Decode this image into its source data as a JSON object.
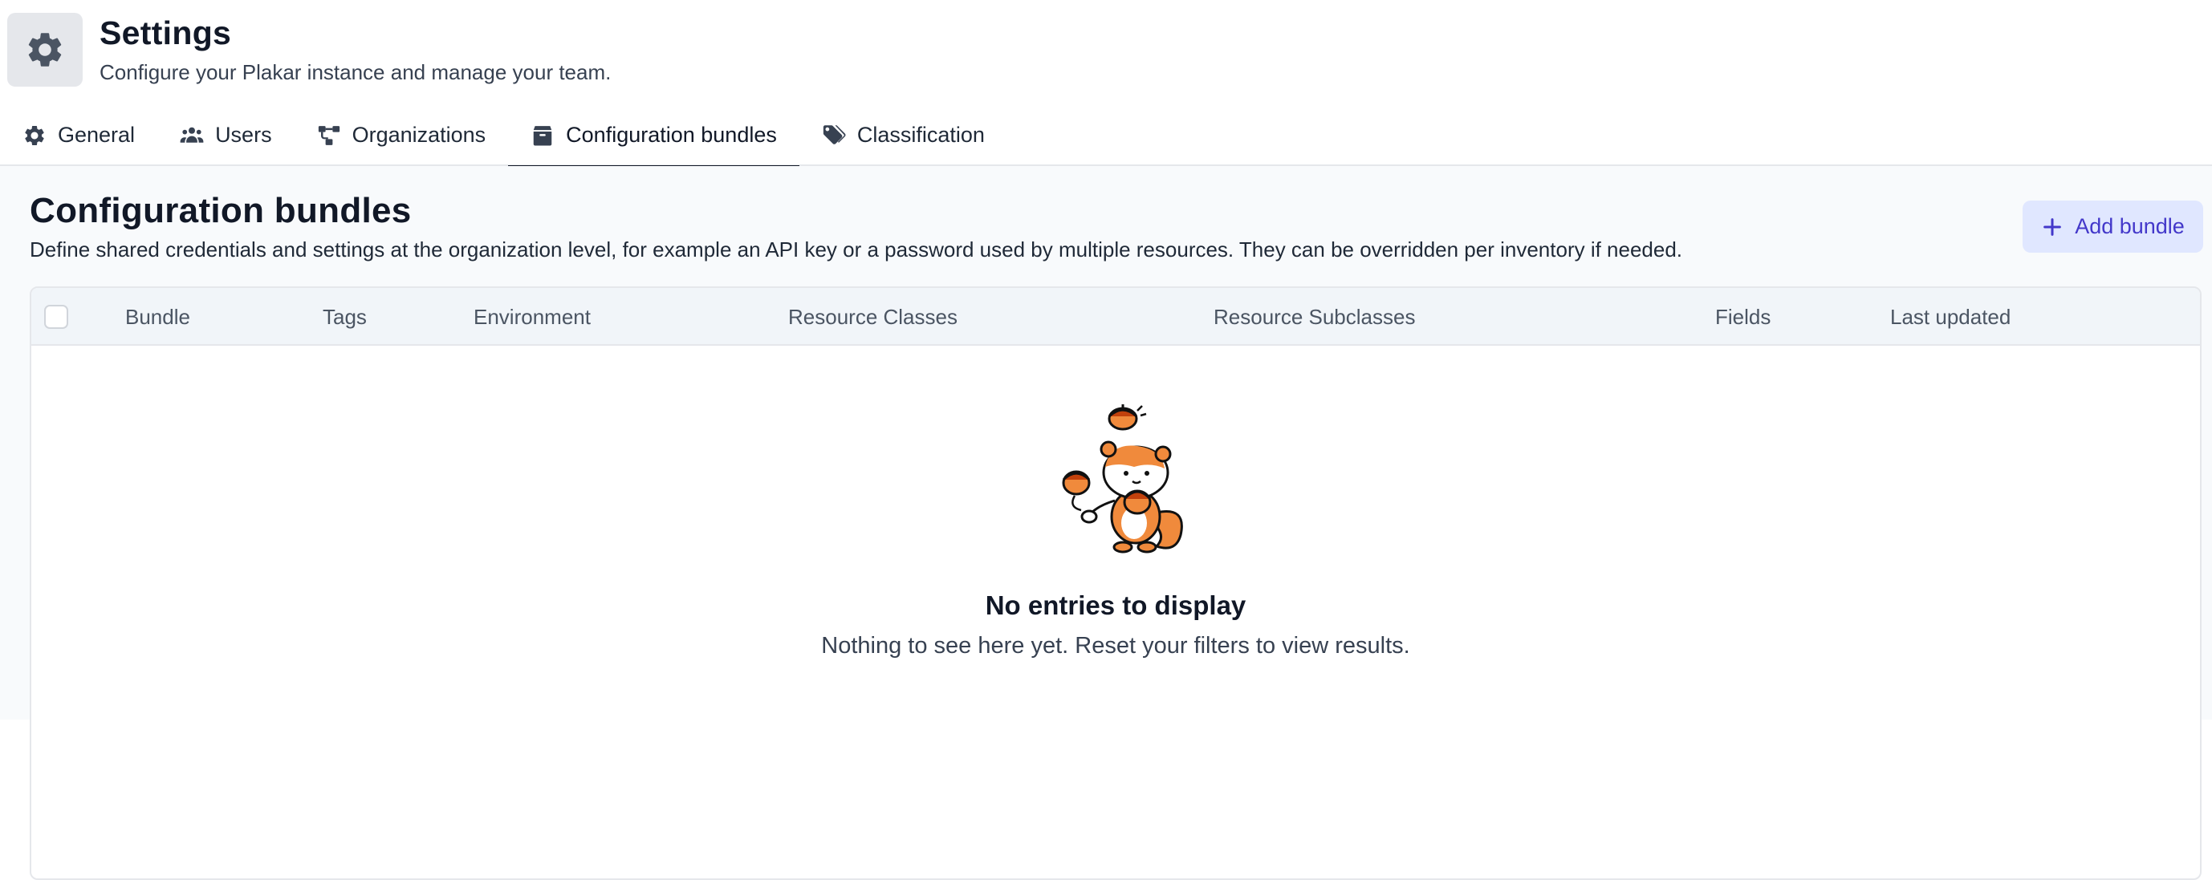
{
  "header": {
    "title": "Settings",
    "subtitle": "Configure your Plakar instance and manage your team."
  },
  "tabs": [
    {
      "label": "General",
      "icon": "gear-icon",
      "active": false
    },
    {
      "label": "Users",
      "icon": "users-icon",
      "active": false
    },
    {
      "label": "Organizations",
      "icon": "org-chart-icon",
      "active": false
    },
    {
      "label": "Configuration bundles",
      "icon": "box-icon",
      "active": true
    },
    {
      "label": "Classification",
      "icon": "tags-icon",
      "active": false
    }
  ],
  "section": {
    "title": "Configuration bundles",
    "description": "Define shared credentials and settings at the organization level, for example an API key or a password used by multiple resources. They can be overridden per inventory if needed.",
    "add_button_label": "Add bundle"
  },
  "table": {
    "columns": [
      "Bundle",
      "Tags",
      "Environment",
      "Resource Classes",
      "Resource Subclasses",
      "Fields",
      "Last updated"
    ]
  },
  "empty_state": {
    "title": "No entries to display",
    "description": "Nothing to see here yet. Reset your filters to view results."
  },
  "colors": {
    "accent": "#4338ca",
    "accent_bg": "#e0e7ff",
    "illustration_orange": "#f08a3c"
  }
}
